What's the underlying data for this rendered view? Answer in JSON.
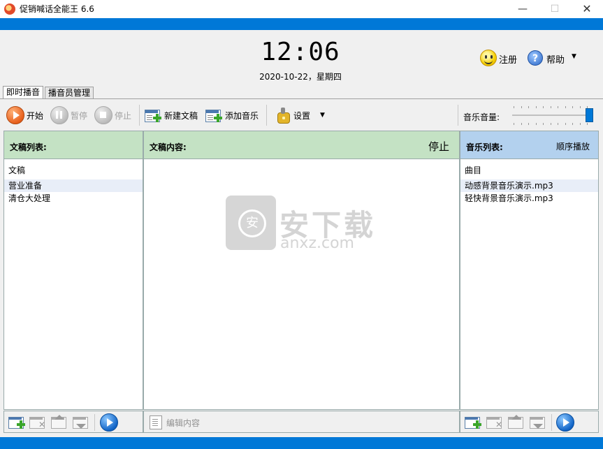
{
  "window": {
    "title": "促销喊话全能王 6.6",
    "minimize_glyph": "—",
    "maximize_glyph": "☐",
    "close_glyph": "✕"
  },
  "header": {
    "time": "12:06",
    "date": "2020-10-22，星期四",
    "register_label": "注册",
    "help_label": "帮助",
    "help_glyph": "?",
    "dropdown_glyph": "▼"
  },
  "tabs": [
    {
      "label": "即时播音",
      "active": true
    },
    {
      "label": "播音员管理",
      "active": false
    }
  ],
  "toolbar": {
    "start_label": "开始",
    "pause_label": "暂停",
    "stop_label": "停止",
    "new_doc_label": "新建文稿",
    "add_music_label": "添加音乐",
    "settings_label": "设置",
    "settings_dropdown_glyph": "▼",
    "volume_label": "音乐音量:",
    "volume_level": 1.0
  },
  "docs_panel": {
    "title": "文稿列表:",
    "column_header": "文稿",
    "items": [
      "营业准备",
      "清仓大处理"
    ]
  },
  "content_panel": {
    "title": "文稿内容:",
    "status": "停止",
    "edit_label": "编辑内容"
  },
  "music_panel": {
    "title": "音乐列表:",
    "mode": "顺序播放",
    "column_header": "曲目",
    "items": [
      "动感背景音乐演示.mp3",
      "轻快背景音乐演示.mp3"
    ]
  },
  "watermark": {
    "text": "安下载",
    "sub": "anxz.com"
  },
  "colors": {
    "accent_blue": "#0078d7",
    "docs_header_green": "#c4e2c4",
    "music_header_blue": "#b3d1ee"
  }
}
